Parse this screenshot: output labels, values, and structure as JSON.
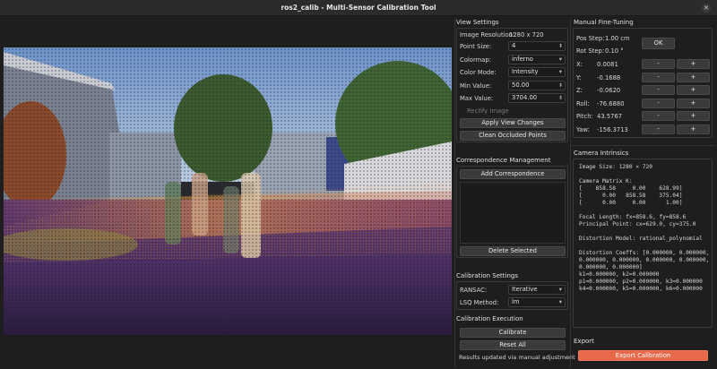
{
  "window": {
    "title": "ros2_calib - Multi-Sensor Calibration Tool",
    "close_glyph": "✕"
  },
  "view_settings": {
    "title": "View Settings",
    "image_resolution_label": "Image Resolution:",
    "image_resolution_value": "1280 x 720",
    "point_size_label": "Point Size:",
    "point_size_value": "4",
    "colormap_label": "Colormap:",
    "colormap_value": "inferno",
    "color_mode_label": "Color Mode:",
    "color_mode_value": "Intensity",
    "min_value_label": "Min Value:",
    "min_value_value": "50.00",
    "max_value_label": "Max Value:",
    "max_value_value": "3704.00",
    "rectify_label": "Rectify Image",
    "apply_button": "Apply View Changes",
    "clean_button": "Clean Occluded Points"
  },
  "correspondence": {
    "title": "Correspondence Management",
    "add_button": "Add Correspondence",
    "delete_button": "Delete Selected"
  },
  "calibration_settings": {
    "title": "Calibration Settings",
    "ransac_label": "RANSAC:",
    "ransac_value": "Iterative",
    "lsq_label": "LSQ Method:",
    "lsq_value": "lm"
  },
  "calibration_execution": {
    "title": "Calibration Execution",
    "calibrate_button": "Calibrate",
    "reset_button": "Reset All",
    "status": "Results updated via manual adjustment"
  },
  "fine_tuning": {
    "title": "Manual Fine-Tuning",
    "pos_step_label": "Pos Step:",
    "pos_step_value": "1.00 cm",
    "rot_step_label": "Rot Step:",
    "rot_step_value": "0.10 °",
    "ok_button": "OK",
    "minus": "-",
    "plus": "+",
    "rows": [
      {
        "label": "X:",
        "value": "0.0081"
      },
      {
        "label": "Y:",
        "value": "-0.1688"
      },
      {
        "label": "Z:",
        "value": "-0.0620"
      },
      {
        "label": "Roll:",
        "value": "-76.6880"
      },
      {
        "label": "Pitch:",
        "value": "43.5767"
      },
      {
        "label": "Yaw:",
        "value": "-156.3713"
      }
    ]
  },
  "intrinsics": {
    "title": "Camera Intrinsics",
    "lines": [
      "Image Size: 1280 × 720",
      "",
      "Camera Matrix K:",
      "[    858.58     0.00    628.99]",
      "[      0.00   858.58    375.04]",
      "[      0.00     0.00      1.00]",
      "",
      "Focal Length: fx=858.6, fy=858.6",
      "Principal Point: cx=629.0, cy=375.0",
      "",
      "Distortion Model: rational_polynomial",
      "",
      "Distortion Coeffs: [0.000000, 0.000000,",
      "0.000000, 0.000000, 0.000000, 0.000000,",
      "0.000000, 0.000000]",
      "k1=0.000000, k2=0.000000",
      "p1=0.000000, p2=0.000000, k3=0.000000",
      "k4=0.000000, k5=0.000000, k6=0.000000"
    ]
  },
  "export": {
    "title": "Export",
    "button": "Export Calibration"
  }
}
